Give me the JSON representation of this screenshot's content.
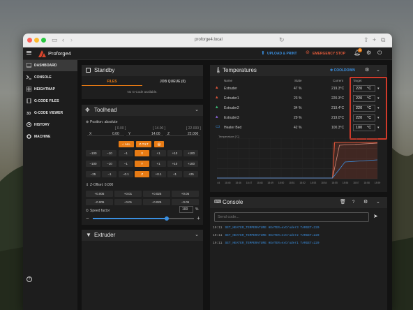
{
  "browser": {
    "url": "proforge4.local"
  },
  "app": {
    "name": "Proforge4",
    "upload": "UPLOAD & PRINT",
    "estop": "EMERGENCY STOP",
    "notif_count": "1"
  },
  "nav": [
    "DASHBOARD",
    "CONSOLE",
    "HEIGHTMAP",
    "G-CODE FILES",
    "G-CODE VIEWER",
    "HISTORY",
    "MACHINE"
  ],
  "standby": {
    "title": "Standby",
    "tab_files": "FILES",
    "tab_queue": "JOB QUEUE (0)",
    "empty": "No G-Code available."
  },
  "toolhead": {
    "title": "Toolhead",
    "position": "Position: absolute",
    "axes": [
      {
        "label": "X",
        "sub": "[ 0.00 ]",
        "value": "0.00"
      },
      {
        "label": "Y",
        "sub": "[ 14.00 ]",
        "value": "14.00"
      },
      {
        "label": "Z",
        "sub": "[ 22.000 ]",
        "value": "22.000"
      }
    ],
    "home_all": "ALL",
    "qgl": "Z-TILT",
    "row1": [
      "−100",
      "−10",
      "−1",
      "X",
      "+1",
      "+10",
      "+100"
    ],
    "row2": [
      "−100",
      "−10",
      "−1",
      "Y",
      "+1",
      "+10",
      "+100"
    ],
    "row3": [
      "−25",
      "−1",
      "−0.1",
      "Z",
      "+0.1",
      "+1",
      "+25"
    ],
    "zoffset": "Z-Offset: 0.000",
    "zoff_up": [
      "+0.005",
      "+0.01",
      "+0.025",
      "+0.05"
    ],
    "zoff_down": [
      "−0.005",
      "−0.01",
      "−0.025",
      "−0.05"
    ],
    "speed_label": "Speed factor",
    "speed_value": "100",
    "speed_unit": "%",
    "speed_fraction": 0.73
  },
  "extruder_card": {
    "title": "Extruder"
  },
  "temps": {
    "title": "Temperatures",
    "cooldown": "COOLDOWN",
    "headers": {
      "name": "Name",
      "state": "State",
      "current": "Current",
      "target": "Target"
    },
    "rows": [
      {
        "name": "Extruder",
        "state": "47 %",
        "current": "219.3°C",
        "target": "220",
        "unit": "°C",
        "color": "#e0553a"
      },
      {
        "name": "Extruder1",
        "state": "23 %",
        "current": "220.3°C",
        "target": "220",
        "unit": "°C",
        "color": "#e0553a"
      },
      {
        "name": "Extruder2",
        "state": "34 %",
        "current": "219.4°C",
        "target": "220",
        "unit": "°C",
        "color": "#3cc47a"
      },
      {
        "name": "Extruder3",
        "state": "29 %",
        "current": "219.0°C",
        "target": "220",
        "unit": "°C",
        "color": "#8a62d8"
      },
      {
        "name": "Heater Bed",
        "state": "42 %",
        "current": "100.3°C",
        "target": "100",
        "unit": "°C",
        "color": "#3a8fe0"
      }
    ],
    "graph_label": "Temperature [°C]",
    "xticks": [
      "18:44",
      "18:45",
      "18:46",
      "18:47",
      "18:48",
      "18:49",
      "18:50",
      "18:51",
      "18:52",
      "18:53",
      "18:54",
      "18:55",
      "18:56",
      "18:57",
      "18:58",
      "18:59"
    ]
  },
  "console": {
    "title": "Console",
    "placeholder": "Send code...",
    "lines": [
      {
        "time": "19:11",
        "text": "SET_HEATER_TEMPERATURE HEATER=extruder3 TARGET=220"
      },
      {
        "time": "19:11",
        "text": "SET_HEATER_TEMPERATURE HEATER=extruder2 TARGET=220"
      },
      {
        "time": "19:11",
        "text": "SET_HEATER_TEMPERATURE HEATER=extruder1 TARGET=220"
      }
    ]
  },
  "colors": {
    "accent": "#e87b14",
    "highlight": "#d03a2a",
    "link": "#3a8fe0",
    "estop": "#e05a3a"
  }
}
